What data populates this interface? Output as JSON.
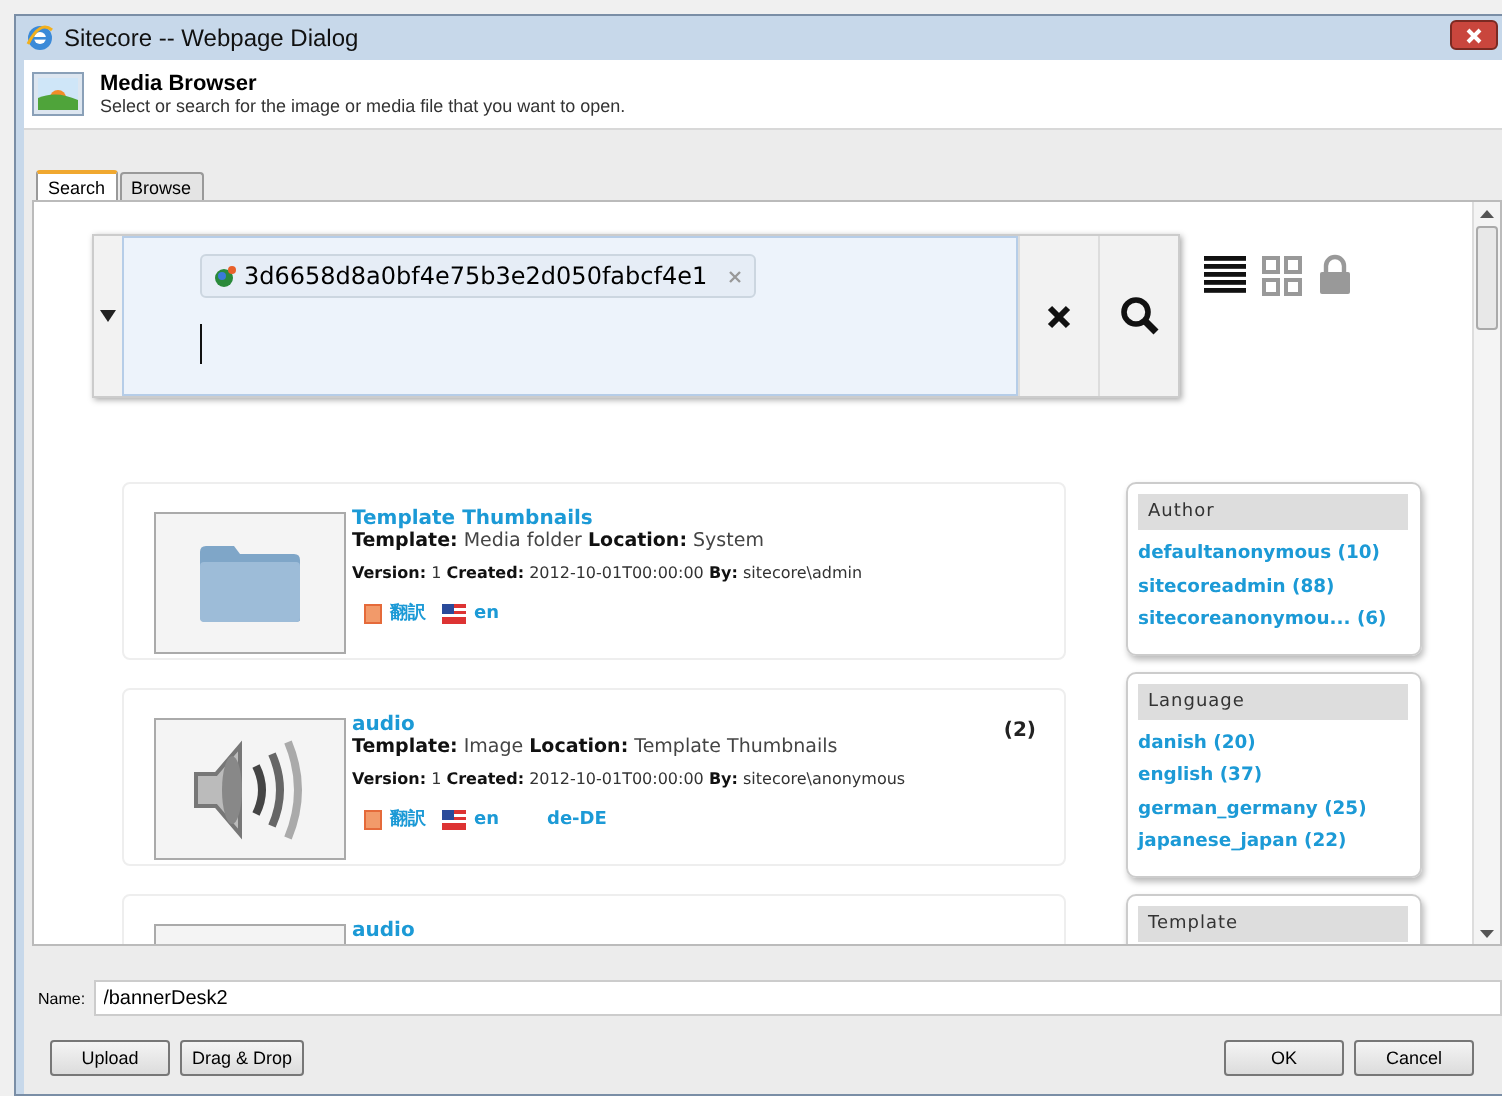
{
  "window": {
    "title": "Sitecore -- Webpage Dialog"
  },
  "header": {
    "title": "Media Browser",
    "subtitle": "Select or search for the image or media file that you want to open."
  },
  "tabs": [
    {
      "label": "Search",
      "selected": true
    },
    {
      "label": "Browse",
      "selected": false
    }
  ],
  "search": {
    "tokens": [
      {
        "text": "3d6658d8a0bf4e75b3e2d050fabcf4e1"
      }
    ]
  },
  "results": [
    {
      "kind": "folder",
      "title": "Template Thumbnails",
      "details": "**Template:** Media folder **Location:** System",
      "meta": "**Version:** 1 **Created:** 2012-10-01T00:00:00 **By:** sitecore\\admin",
      "languages": [
        {
          "kind": "translate",
          "text": "翻訳"
        },
        {
          "kind": "flag",
          "text": "en"
        }
      ]
    },
    {
      "kind": "audio",
      "title": "audio",
      "count": "(2)",
      "details": "**Template:** Image **Location:** Template Thumbnails",
      "meta": "**Version:** 1 **Created:** 2012-10-01T00:00:00 **By:** sitecore\\anonymous",
      "languages": [
        {
          "kind": "translate",
          "text": "翻訳"
        },
        {
          "kind": "flag",
          "text": "en"
        },
        {
          "kind": "plain",
          "text": "de-DE"
        }
      ]
    },
    {
      "title": "audio"
    }
  ],
  "facets": [
    {
      "title": "Author",
      "items": [
        "defaultanonymous (10)",
        "sitecoreadmin (88)",
        "sitecoreanonymou... (6)"
      ]
    },
    {
      "title": "Language",
      "items": [
        "danish (20)",
        "english (37)",
        "german_germany (25)",
        "japanese_japan (22)"
      ]
    },
    {
      "title": "Template"
    }
  ],
  "name": {
    "label": "Name:",
    "value": "/bannerDesk2"
  },
  "buttons_left": [
    "Upload",
    "Drag & Drop"
  ],
  "buttons_right": [
    "OK",
    "Cancel"
  ]
}
